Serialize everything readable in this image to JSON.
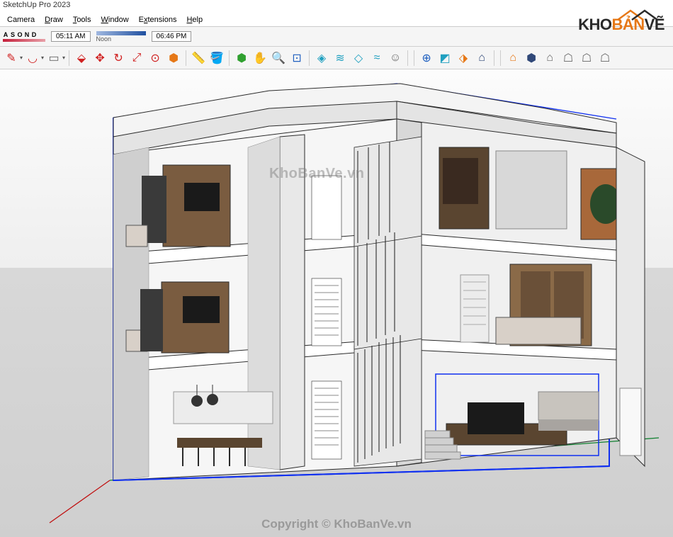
{
  "title_bar": "SketchUp Pro 2023",
  "menu": {
    "camera": "Camera",
    "draw": "Draw",
    "tools": "Tools",
    "window": "Window",
    "extensions": "Extensions",
    "help": "Help"
  },
  "shadow": {
    "months": [
      "A",
      "S",
      "O",
      "N",
      "D"
    ],
    "time_start": "05:11 AM",
    "noon": "Noon",
    "time_end": "06:46 PM"
  },
  "toolbar": {
    "pencil": "✎",
    "arc": "◡",
    "rect": "▭",
    "pushpull": "⬙",
    "move": "✥",
    "rotate": "↻",
    "scale": "⤢",
    "offset": "⊙",
    "tape": "📏",
    "paint": "🪣",
    "eraser": "⌫",
    "orbit": "⟲",
    "pan": "✋",
    "zoom": "🔍",
    "zoomext": "⊡",
    "tag1": "◈",
    "tag2": "≋",
    "tag3": "◇",
    "tag4": "≈",
    "person": "☺",
    "nav1": "⊕",
    "nav2": "◩",
    "nav3": "⬗",
    "nav4": "⌂",
    "wh1": "⌂",
    "wh2": "⬢",
    "wh3": "⌂",
    "wh4": "☖",
    "wh5": "☖",
    "wh6": "☖"
  },
  "watermark": {
    "top": "KhoBanVe.vn",
    "bottom": "Copyright © KhoBanVe.vn"
  },
  "logo": {
    "part1": "KHO",
    "part2": "BẢN",
    "part3": "VẼ"
  },
  "colors": {
    "selection": "#1030f0",
    "axis_red": "#c01010",
    "axis_green": "#108030",
    "wall": "#f8f8f8",
    "wall_shade": "#d8d8d8",
    "wood": "#8a6a48",
    "wood_dark": "#5a4530",
    "dark": "#2a2a2a",
    "floor": "#888"
  }
}
